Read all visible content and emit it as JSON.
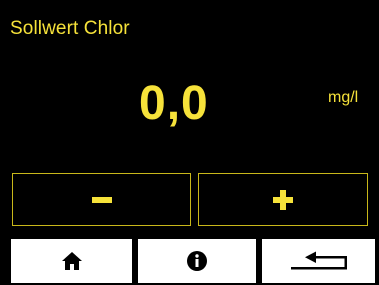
{
  "screen": {
    "title": "Sollwert Chlor",
    "value": "0,0",
    "unit": "mg/l"
  },
  "controls": {
    "decrement_icon": "minus-icon",
    "increment_icon": "plus-icon"
  },
  "nav": {
    "items": [
      {
        "icon": "home-icon"
      },
      {
        "icon": "info-icon"
      },
      {
        "icon": "back-arrow-icon"
      }
    ]
  },
  "colors": {
    "background": "#000000",
    "accent": "#f6e23a",
    "border": "#c9b81a",
    "nav_button": "#ffffff",
    "nav_icon": "#000000"
  }
}
